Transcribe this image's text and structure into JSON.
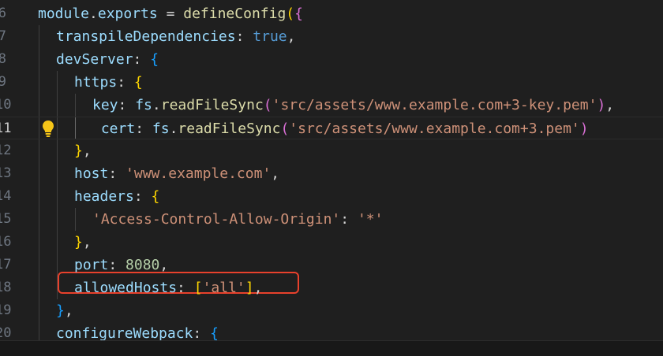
{
  "editor": {
    "lines": [
      {
        "number": "6",
        "indent": 0,
        "tokens": [
          {
            "t": "module",
            "c": "t-var"
          },
          {
            "t": ".",
            "c": "t-plain"
          },
          {
            "t": "exports",
            "c": "t-var"
          },
          {
            "t": " = ",
            "c": "t-plain"
          },
          {
            "t": "defineConfig",
            "c": "t-fn"
          },
          {
            "t": "(",
            "c": "t-b1"
          },
          {
            "t": "{",
            "c": "t-b2"
          }
        ]
      },
      {
        "number": "7",
        "indent": 1,
        "tokens": [
          {
            "t": "transpileDependencies",
            "c": "t-var"
          },
          {
            "t": ": ",
            "c": "t-plain"
          },
          {
            "t": "true",
            "c": "t-kw"
          },
          {
            "t": ",",
            "c": "t-plain"
          }
        ]
      },
      {
        "number": "8",
        "indent": 1,
        "tokens": [
          {
            "t": "devServer",
            "c": "t-var"
          },
          {
            "t": ": ",
            "c": "t-plain"
          },
          {
            "t": "{",
            "c": "t-b3"
          }
        ]
      },
      {
        "number": "9",
        "indent": 2,
        "tokens": [
          {
            "t": "https",
            "c": "t-var"
          },
          {
            "t": ": ",
            "c": "t-plain"
          },
          {
            "t": "{",
            "c": "t-b1"
          }
        ]
      },
      {
        "number": "10",
        "indent": 3,
        "tokens": [
          {
            "t": "key",
            "c": "t-var"
          },
          {
            "t": ": ",
            "c": "t-plain"
          },
          {
            "t": "fs",
            "c": "t-var"
          },
          {
            "t": ".",
            "c": "t-plain"
          },
          {
            "t": "readFileSync",
            "c": "t-fn"
          },
          {
            "t": "(",
            "c": "t-b2"
          },
          {
            "t": "'src/assets/www.example.com+3-key.pem'",
            "c": "t-str"
          },
          {
            "t": ")",
            "c": "t-b2"
          },
          {
            "t": ",",
            "c": "t-plain"
          }
        ]
      },
      {
        "number": "11",
        "indent": 3,
        "active": true,
        "bulb": true,
        "tokens": [
          {
            "t": " cert",
            "c": "t-var"
          },
          {
            "t": ": ",
            "c": "t-plain"
          },
          {
            "t": "fs",
            "c": "t-var"
          },
          {
            "t": ".",
            "c": "t-plain"
          },
          {
            "t": "readFileSync",
            "c": "t-fn"
          },
          {
            "t": "(",
            "c": "t-b2"
          },
          {
            "t": "'src/assets/www.example.com+3.pem'",
            "c": "t-str"
          },
          {
            "t": ")",
            "c": "t-b2"
          }
        ]
      },
      {
        "number": "12",
        "indent": 2,
        "tokens": [
          {
            "t": "}",
            "c": "t-b1"
          },
          {
            "t": ",",
            "c": "t-plain"
          }
        ]
      },
      {
        "number": "13",
        "indent": 2,
        "tokens": [
          {
            "t": "host",
            "c": "t-var"
          },
          {
            "t": ": ",
            "c": "t-plain"
          },
          {
            "t": "'www.example.com'",
            "c": "t-str"
          },
          {
            "t": ",",
            "c": "t-plain"
          }
        ]
      },
      {
        "number": "14",
        "indent": 2,
        "tokens": [
          {
            "t": "headers",
            "c": "t-var"
          },
          {
            "t": ": ",
            "c": "t-plain"
          },
          {
            "t": "{",
            "c": "t-b1"
          }
        ]
      },
      {
        "number": "15",
        "indent": 3,
        "tokens": [
          {
            "t": "'Access-Control-Allow-Origin'",
            "c": "t-str"
          },
          {
            "t": ": ",
            "c": "t-plain"
          },
          {
            "t": "'*'",
            "c": "t-str"
          }
        ]
      },
      {
        "number": "16",
        "indent": 2,
        "tokens": [
          {
            "t": "}",
            "c": "t-b1"
          },
          {
            "t": ",",
            "c": "t-plain"
          }
        ]
      },
      {
        "number": "17",
        "indent": 2,
        "tokens": [
          {
            "t": "port",
            "c": "t-var"
          },
          {
            "t": ": ",
            "c": "t-plain"
          },
          {
            "t": "8080",
            "c": "t-num"
          },
          {
            "t": ",",
            "c": "t-plain"
          }
        ]
      },
      {
        "number": "18",
        "indent": 2,
        "highlighted": true,
        "tokens": [
          {
            "t": "allowedHosts",
            "c": "t-var"
          },
          {
            "t": ": ",
            "c": "t-plain"
          },
          {
            "t": "[",
            "c": "t-b1"
          },
          {
            "t": "'all'",
            "c": "t-str"
          },
          {
            "t": "]",
            "c": "t-b1"
          },
          {
            "t": ",",
            "c": "t-plain"
          }
        ]
      },
      {
        "number": "19",
        "indent": 1,
        "tokens": [
          {
            "t": "}",
            "c": "t-b3"
          },
          {
            "t": ",",
            "c": "t-plain"
          }
        ]
      },
      {
        "number": "20",
        "indent": 1,
        "tokens": [
          {
            "t": "configureWebpack",
            "c": "t-var"
          },
          {
            "t": ": ",
            "c": "t-plain"
          },
          {
            "t": "{",
            "c": "t-b3"
          }
        ]
      }
    ]
  },
  "icons": {
    "lightbulb": "lightbulb-icon"
  },
  "colors": {
    "highlight_box": "#e8412c",
    "background": "#1f1f1f",
    "lightbulb": "#f5c518"
  }
}
